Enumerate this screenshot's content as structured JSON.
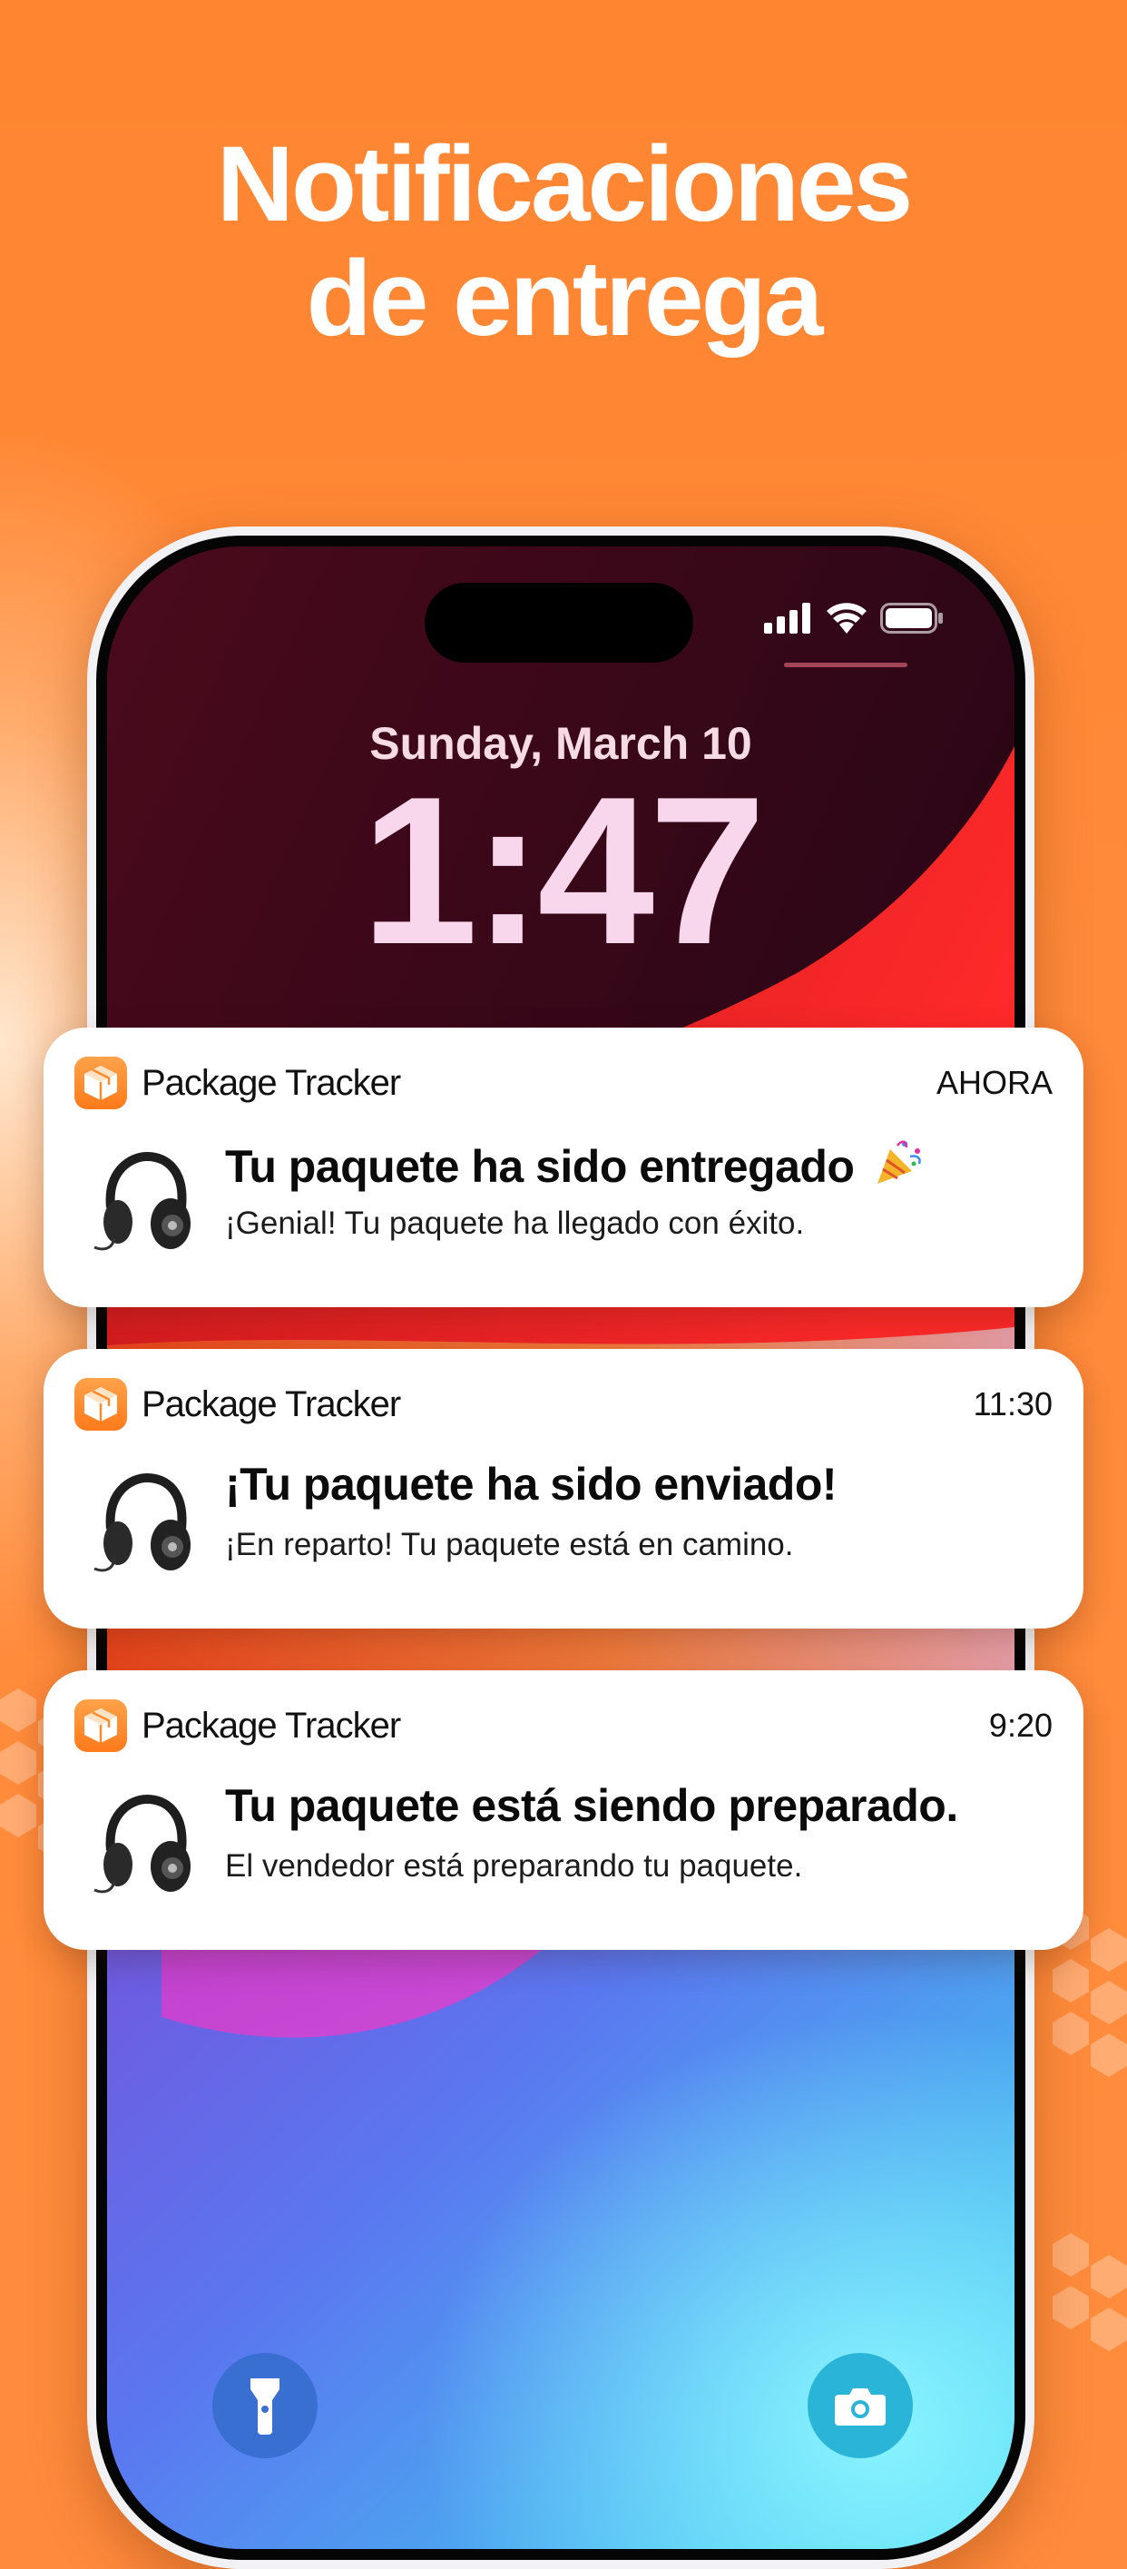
{
  "headline": {
    "line1": "Notificaciones",
    "line2": "de entrega"
  },
  "lockscreen": {
    "date": "Sunday, March 10",
    "time": "1:47",
    "status_icons": [
      "cellular-signal-icon",
      "wifi-icon",
      "battery-icon"
    ],
    "buttons": {
      "left": "flashlight-icon",
      "right": "camera-icon"
    }
  },
  "notifications": [
    {
      "app_name": "Package Tracker",
      "time": "AHORA",
      "title": "Tu paquete ha sido entregado",
      "title_icon": "party-popper-icon",
      "body": "¡Genial! Tu paquete ha llegado con éxito.",
      "image": "headphones-image"
    },
    {
      "app_name": "Package Tracker",
      "time": "11:30",
      "title": "¡Tu paquete ha sido enviado!",
      "body": "¡En reparto! Tu paquete está en camino.",
      "image": "headphones-image"
    },
    {
      "app_name": "Package Tracker",
      "time": "9:20",
      "title": "Tu paquete está siendo preparado.",
      "body": "El vendedor está preparando tu paquete.",
      "image": "headphones-image"
    }
  ],
  "colors": {
    "background": "#ff8a3c",
    "app_icon": "#ff8a2a",
    "text_white": "#ffffff"
  }
}
